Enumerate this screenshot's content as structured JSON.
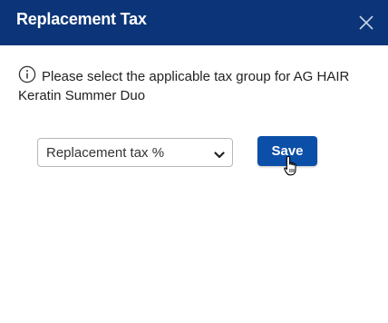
{
  "dialog": {
    "title": "Replacement Tax",
    "close_icon": "close-icon",
    "message": "Please select the applicable tax group for AG HAIR Keratin Summer Duo",
    "info_icon": "info-icon",
    "tax_select": {
      "value": "Replacement tax %"
    },
    "save_label": "Save"
  },
  "colors": {
    "header_bg": "#0b3578",
    "primary_button": "#0b4fa8"
  }
}
